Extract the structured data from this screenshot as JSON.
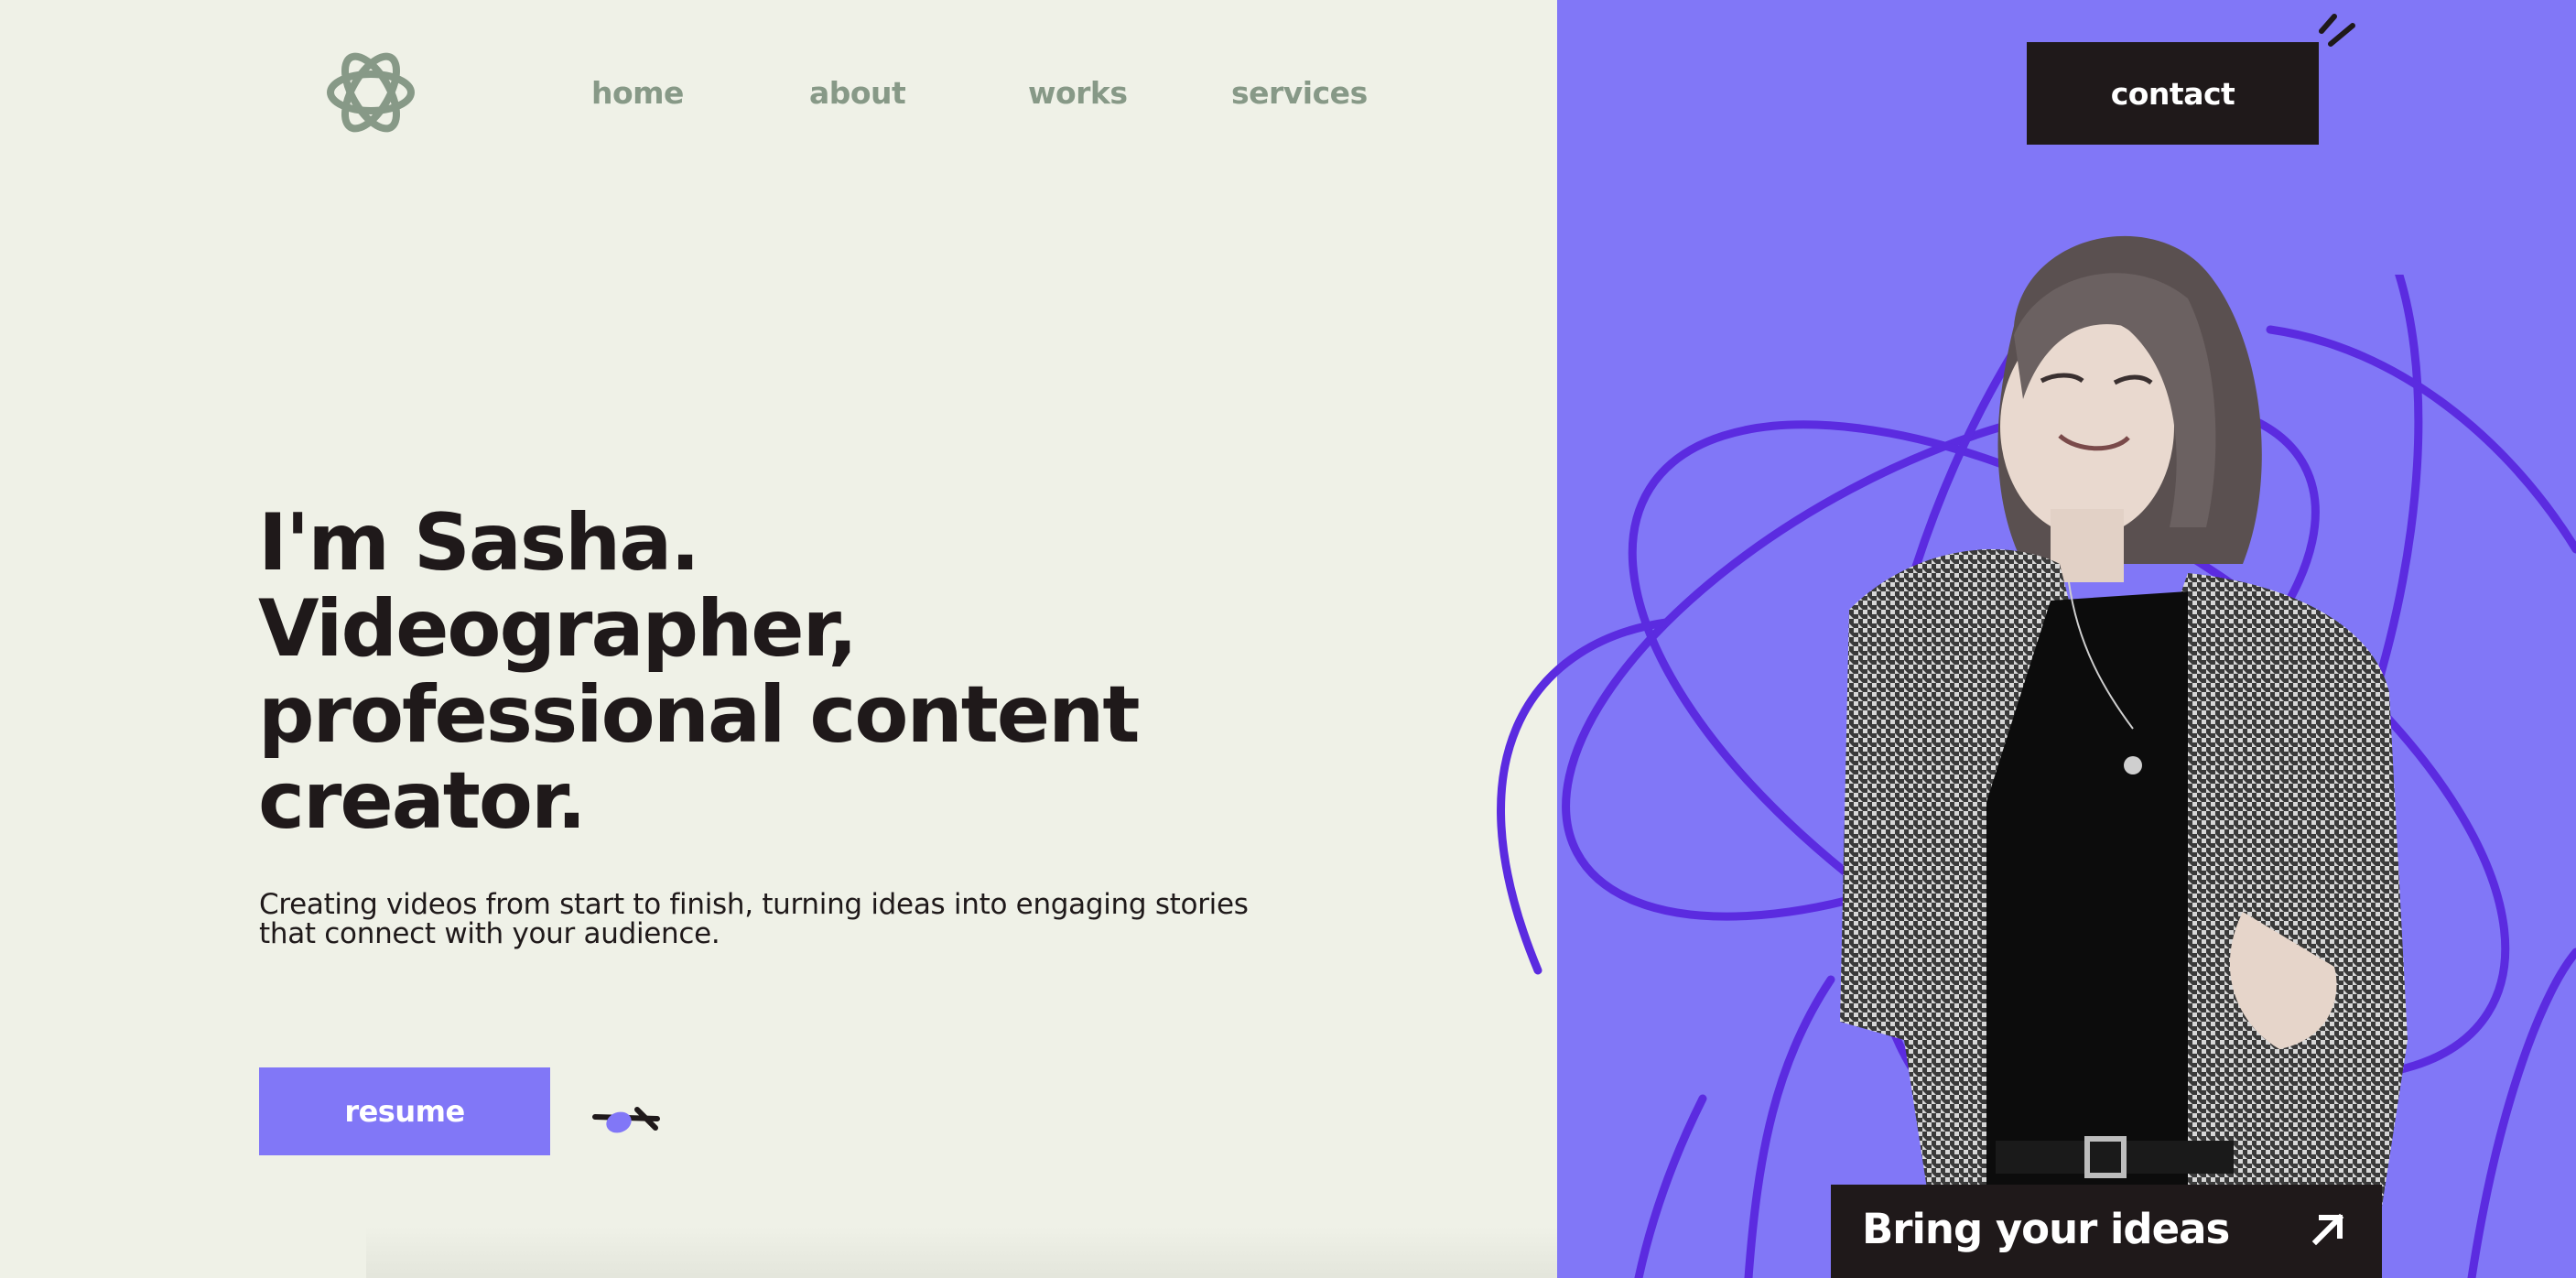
{
  "nav": {
    "logo_icon": "interlaced-knot-logo",
    "links": [
      "home",
      "about",
      "works",
      "services"
    ],
    "contact_label": "contact"
  },
  "hero": {
    "headline_lines": [
      "I'm Sasha.",
      "Videographer,",
      "professional content",
      "creator."
    ],
    "subtitle_lines": [
      "Creating videos from start to finish, turning ideas into engaging stories",
      "that connect with your audience."
    ],
    "resume_label": "resume",
    "cta_label": "Bring your ideas",
    "cta_icon": "arrow-up-right-icon"
  },
  "colors": {
    "background": "#eff1e7",
    "accent_purple": "#8177f7",
    "orbit_purple": "#5b2be0",
    "dark": "#1f191a",
    "nav_green": "#879987"
  }
}
